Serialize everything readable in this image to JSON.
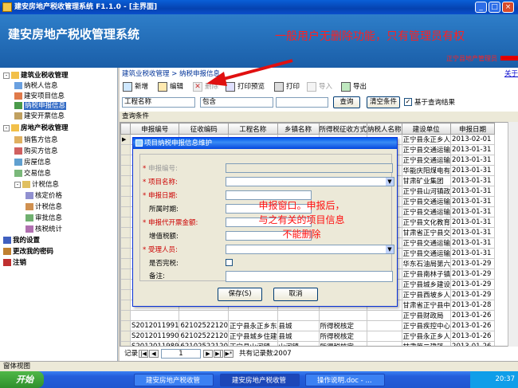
{
  "window": {
    "title": "建安房地产税收管理系统 F1.1.0 - [主界面]",
    "min": "_",
    "max": "□",
    "close": "×"
  },
  "banner": {
    "title": "建安房地产税收管理系统",
    "note": "一般用户无删除功能，只有管理员有权",
    "user": "正宁县地产管理员"
  },
  "about": "关于",
  "sidebar": [
    {
      "label": "建筑业税收管理",
      "level": 0,
      "bold": true,
      "expander": "-"
    },
    {
      "label": "纳税人信息",
      "level": 1
    },
    {
      "label": "建安项目信息",
      "level": 1
    },
    {
      "label": "纳税申报信息",
      "level": 1,
      "selected": true
    },
    {
      "label": "建安开票信息",
      "level": 1
    },
    {
      "label": "房地产税收管理",
      "level": 0,
      "bold": true,
      "expander": "-"
    },
    {
      "label": "销售方信息",
      "level": 1
    },
    {
      "label": "购买方信息",
      "level": 1
    },
    {
      "label": "房屋信息",
      "level": 1
    },
    {
      "label": "交易信息",
      "level": 1
    },
    {
      "label": "计税信息",
      "level": 1,
      "expander": "-"
    },
    {
      "label": "核定价格",
      "level": 2
    },
    {
      "label": "计税信息",
      "level": 2
    },
    {
      "label": "审批信息",
      "level": 2
    },
    {
      "label": "核税统计",
      "level": 2
    },
    {
      "label": "我的设置",
      "level": 0,
      "bold": true
    },
    {
      "label": "更改我的密码",
      "level": 0,
      "bold": true
    },
    {
      "label": "注销",
      "level": 0,
      "bold": true
    }
  ],
  "breadcrumb": "建筑业税收管理 > 纳税申报信息",
  "toolbar": {
    "add": "新增",
    "edit": "编辑",
    "delete": "删除",
    "preview": "打印预览",
    "print": "打印",
    "import": "导入",
    "export": "导出"
  },
  "filter": {
    "field": "工程名称",
    "op": "包含",
    "value": "",
    "query": "查询",
    "clear": "清空条件",
    "checkbox": "基于查询结果",
    "checked": true
  },
  "cond_label": "查询条件",
  "grid": {
    "columns": [
      "申报编号",
      "征收编码",
      "工程名称",
      "乡镇名称",
      "所得税征收方式",
      "纳税人名称",
      "建设单位",
      "申报日期"
    ],
    "rows": [
      [
        "",
        "",
        "",
        "",
        "",
        "",
        "正宁县永正乡人",
        "2013-02-01"
      ],
      [
        "",
        "",
        "",
        "",
        "",
        "",
        "正宁县交通运输",
        "2013-01-31"
      ],
      [
        "",
        "",
        "",
        "",
        "",
        "",
        "正宁县交通运输",
        "2013-01-31"
      ],
      [
        "",
        "",
        "",
        "",
        "",
        "",
        "华能庆阳煤电有",
        "2013-01-31"
      ],
      [
        "",
        "",
        "",
        "",
        "",
        "",
        "甘肃矿业集团",
        "2013-01-31"
      ],
      [
        "",
        "",
        "",
        "",
        "",
        "",
        "正宁县山河镇政",
        "2013-01-31"
      ],
      [
        "",
        "",
        "",
        "",
        "",
        "",
        "正宁县交通运输",
        "2013-01-31"
      ],
      [
        "",
        "",
        "",
        "",
        "",
        "",
        "正宁县交通运输",
        "2013-01-31"
      ],
      [
        "",
        "",
        "",
        "",
        "",
        "",
        "正宁县文化教育",
        "2013-01-31"
      ],
      [
        "",
        "",
        "",
        "",
        "",
        "",
        "甘肃省正宁县交",
        "2013-01-31"
      ],
      [
        "",
        "",
        "",
        "",
        "",
        "",
        "正宁县交通运输",
        "2013-01-31"
      ],
      [
        "",
        "",
        "",
        "",
        "",
        "",
        "正宁县交通运输",
        "2013-01-31"
      ],
      [
        "",
        "",
        "",
        "",
        "",
        "",
        "华东石油局第六",
        "2013-01-29"
      ],
      [
        "",
        "",
        "",
        "",
        "",
        "",
        "正宁县南林子镇",
        "2013-01-29"
      ],
      [
        "",
        "",
        "",
        "",
        "",
        "",
        "正宁县城乡建设",
        "2013-01-29"
      ],
      [
        "",
        "",
        "",
        "",
        "",
        "",
        "正宁县西坡乡人",
        "2013-01-29"
      ],
      [
        "",
        "",
        "",
        "",
        "",
        "",
        "甘肃省正宁县中",
        "2013-01-28"
      ],
      [
        "",
        "",
        "",
        "",
        "",
        "",
        "正宁县财政局",
        "2013-01-26"
      ],
      [
        "S2012011991",
        "62102522120",
        "正宁县永正乡东",
        "县城",
        "所得税核定",
        "",
        "正宁县疾控中心",
        "2013-01-26"
      ],
      [
        "S2012011990",
        "62102522120",
        "正宁县城乡住建",
        "县城",
        "所得税核定",
        "",
        "正宁县永正乡人",
        "2013-01-26"
      ],
      [
        "S2012011989",
        "62102522120",
        "正宁县山河镇",
        "山河镇",
        "所得税核定",
        "",
        "甘肃第二建筑",
        "2013-01-26"
      ],
      [
        "S2012011988",
        "62102522617",
        "正宁县2011年",
        "县城",
        "所得税核定",
        "",
        "庆阳市环宇建设",
        "2013-01-26"
      ],
      [
        "S2012011987",
        "62102522120",
        "正宁县三元乡",
        "县城",
        "所得税核定",
        "",
        "正宁县城乡建设",
        "2013-01-26"
      ]
    ]
  },
  "pager": {
    "label": "记录:",
    "current": "1",
    "total_label": "共有记录数:",
    "total": "2007"
  },
  "status": "窗体视图",
  "dialog": {
    "title": "项目纳税申报信息维护",
    "fields": [
      {
        "label": "申报编号:",
        "required": true,
        "disabled": true
      },
      {
        "label": "项目名称:",
        "required": true,
        "dropdown": true
      },
      {
        "label": "申报日期:",
        "required": true
      },
      {
        "label": "所属时期:",
        "required": false
      },
      {
        "label": "申报代开票金额:",
        "required": true
      },
      {
        "label": "增值税额:",
        "required": false
      },
      {
        "label": "受理人员:",
        "required": true,
        "dropdown": true
      },
      {
        "label": "是否完税:",
        "required": false,
        "checkbox": true
      },
      {
        "label": "备注:",
        "required": false
      }
    ],
    "save": "保存(S)",
    "cancel": "取消"
  },
  "annotation": {
    "line1": "申报窗口。申报后，",
    "line2": "与之有关的项目信息",
    "line3": "不能删除"
  },
  "taskbar": {
    "start": "开始",
    "tasks": [
      "建安房地产税收管",
      "建安房地产税收管",
      "操作说明.doc - ..."
    ],
    "time": "20:37"
  }
}
